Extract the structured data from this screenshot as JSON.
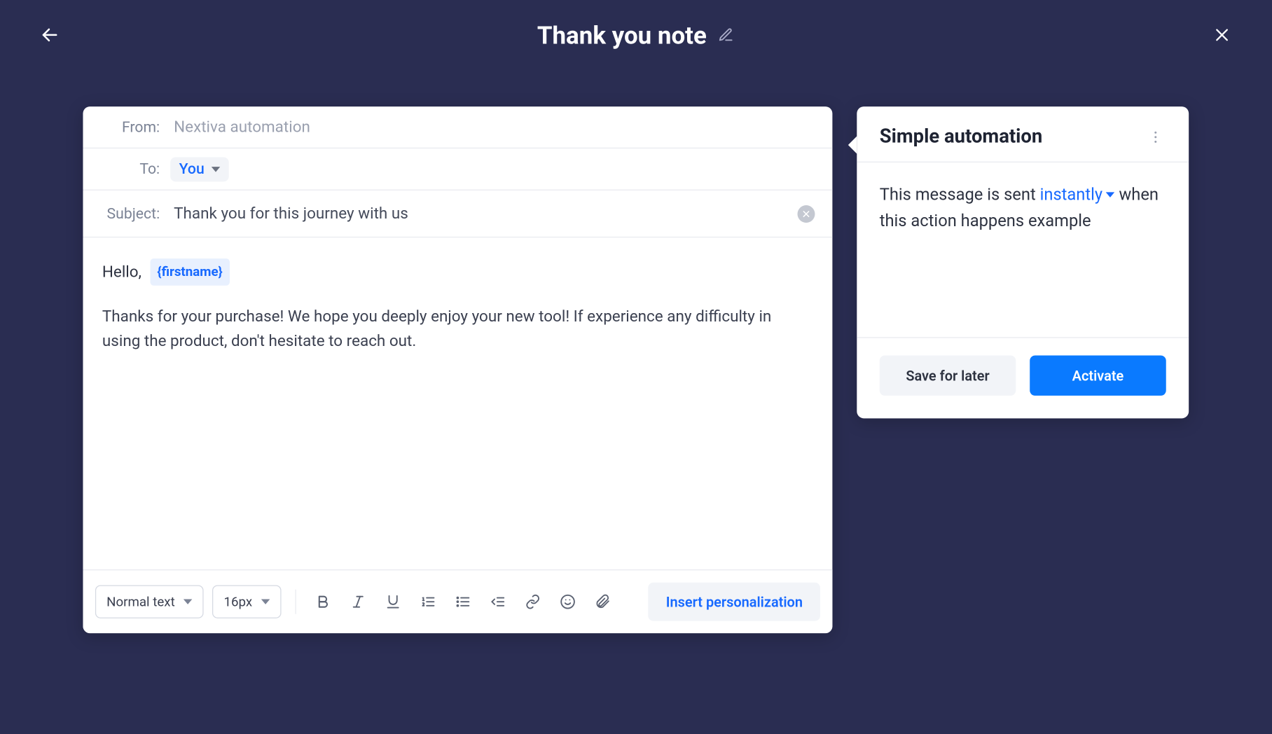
{
  "header": {
    "title": "Thank you note"
  },
  "composer": {
    "from_label": "From:",
    "from_value": "Nextiva automation",
    "to_label": "To:",
    "to_value": "You",
    "subject_label": "Subject:",
    "subject_value": "Thank you for this journey with us",
    "greeting": "Hello,",
    "token": "{firstname}",
    "body": "Thanks for your purchase! We hope you deeply enjoy your new tool! If experience any difficulty in using the product, don't hesitate to reach out."
  },
  "toolbar": {
    "style_select": "Normal text",
    "size_select": "16px",
    "insert_personalization": "Insert personalization"
  },
  "sidepanel": {
    "title": "Simple automation",
    "sentence_pre": "This message is sent",
    "timing": "instantly",
    "sentence_post": "when this action happens example",
    "save_label": "Save for later",
    "activate_label": "Activate"
  }
}
